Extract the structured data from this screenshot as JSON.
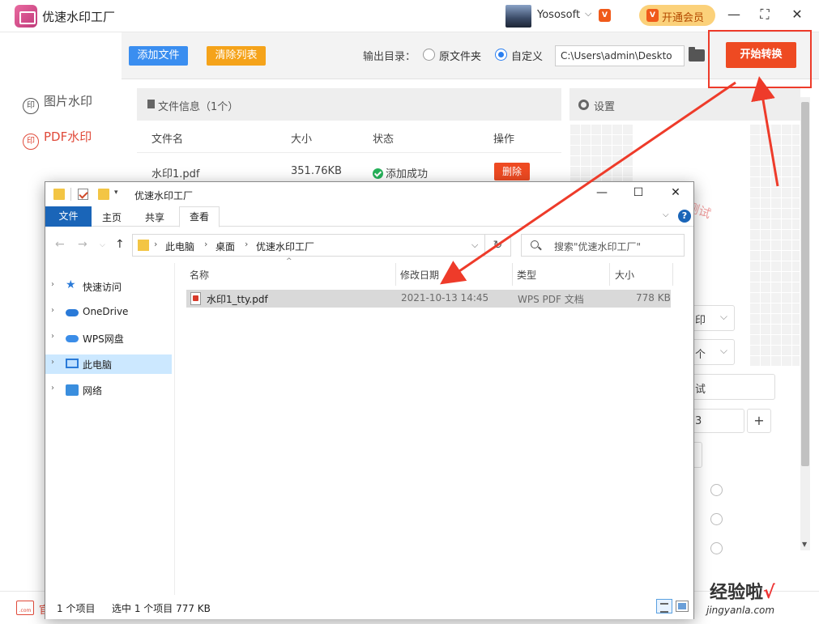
{
  "app": {
    "title": "优速水印工厂",
    "user_name": "Yososoft",
    "user_caret": "⌵",
    "vip_mini": "V",
    "vip_label": "开通会员",
    "win_min": "—",
    "win_max": "⛶",
    "win_close": "✕"
  },
  "sidebar": {
    "items": [
      {
        "icon": "印",
        "label": "图片水印"
      },
      {
        "icon": "印",
        "label": "PDF水印"
      }
    ]
  },
  "toolbar": {
    "add_files": "添加文件",
    "clear_list": "清除列表",
    "output_label": "输出目录：",
    "option_original": "原文件夹",
    "option_custom": "自定义",
    "output_path": "C:\\Users\\admin\\Deskto",
    "start": "开始转换"
  },
  "file_panel": {
    "header": "文件信息（1个）",
    "columns": [
      "文件名",
      "大小",
      "状态",
      "操作"
    ],
    "rows": [
      {
        "name": "水印1.pdf",
        "size": "351.76KB",
        "status": "添加成功",
        "action": "删除"
      }
    ]
  },
  "settings": {
    "header": "设置",
    "watermark_preview": "测试",
    "fields": [
      "印",
      "个",
      "试",
      "3",
      ""
    ],
    "plus": "+"
  },
  "statusbar": {
    "site_icon": ".com",
    "site_text": "官"
  },
  "explorer": {
    "title": "优速水印工厂",
    "quick_drop": "▾",
    "ribbon": {
      "file": "文件",
      "home": "主页",
      "share": "共享",
      "view": "查看",
      "expand": "⌵",
      "help": "?"
    },
    "nav": {
      "back": "←",
      "forward": "→",
      "recent": "⌵",
      "up": "↑",
      "refresh": "↻",
      "caret": "⌵"
    },
    "breadcrumb": [
      "此电脑",
      "桌面",
      "优速水印工厂"
    ],
    "crumb_sep": "›",
    "search_placeholder": "搜索\"优速水印工厂\"",
    "nav_pane": [
      {
        "label": "快速访问"
      },
      {
        "label": "OneDrive"
      },
      {
        "label": "WPS网盘"
      },
      {
        "label": "此电脑"
      },
      {
        "label": "网络"
      }
    ],
    "chevron": "›",
    "star": "★",
    "sort_caret": "^",
    "columns": [
      "名称",
      "修改日期",
      "类型",
      "大小"
    ],
    "files": [
      {
        "name": "水印1_tty.pdf",
        "modified": "2021-10-13 14:45",
        "type": "WPS PDF 文档",
        "size": "778 KB"
      }
    ],
    "status_count": "1 个项目",
    "status_selected": "选中 1 个项目  777 KB"
  },
  "watermark_logo": {
    "text": "经验啦",
    "check": "√",
    "sub": "jingyanla.com"
  },
  "colors": {
    "accent_red": "#ee4a22",
    "blue": "#3a8ef0",
    "orange": "#f5a31a"
  }
}
